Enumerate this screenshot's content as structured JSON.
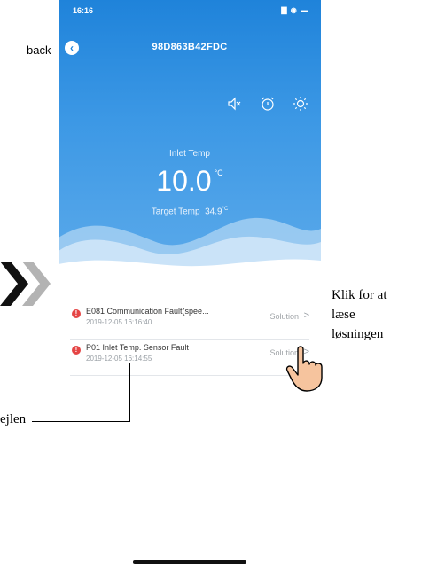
{
  "status_bar": {
    "time": "16:16",
    "icons": "▇ ◉ ▬"
  },
  "header": {
    "back_icon": "‹",
    "device_id": "98D863B42FDC"
  },
  "controls": [
    "mute-icon",
    "alarm-clock-icon",
    "sun-icon"
  ],
  "temps": {
    "inlet_label": "Inlet Temp",
    "inlet_value": "10.0",
    "inlet_unit": "°C",
    "target_label": "Target Temp",
    "target_value": "34.9",
    "target_unit": "°C"
  },
  "faults": [
    {
      "title": "E081 Communication Fault(spee...",
      "time": "2019-12-05 16:16:40",
      "solution": "Solution",
      "arrow": ">"
    },
    {
      "title": "P01 Inlet Temp. Sensor Fault",
      "time": "2019-12-05 16:14:55",
      "solution": "Solution",
      "arrow": ">"
    }
  ],
  "annotations": {
    "back": "back",
    "solution_1": "Klik for at",
    "solution_2": "læse",
    "solution_3": "løsningen",
    "fault": "ejlen"
  },
  "colors": {
    "accent": "#1f83da",
    "fault": "#e54545"
  }
}
